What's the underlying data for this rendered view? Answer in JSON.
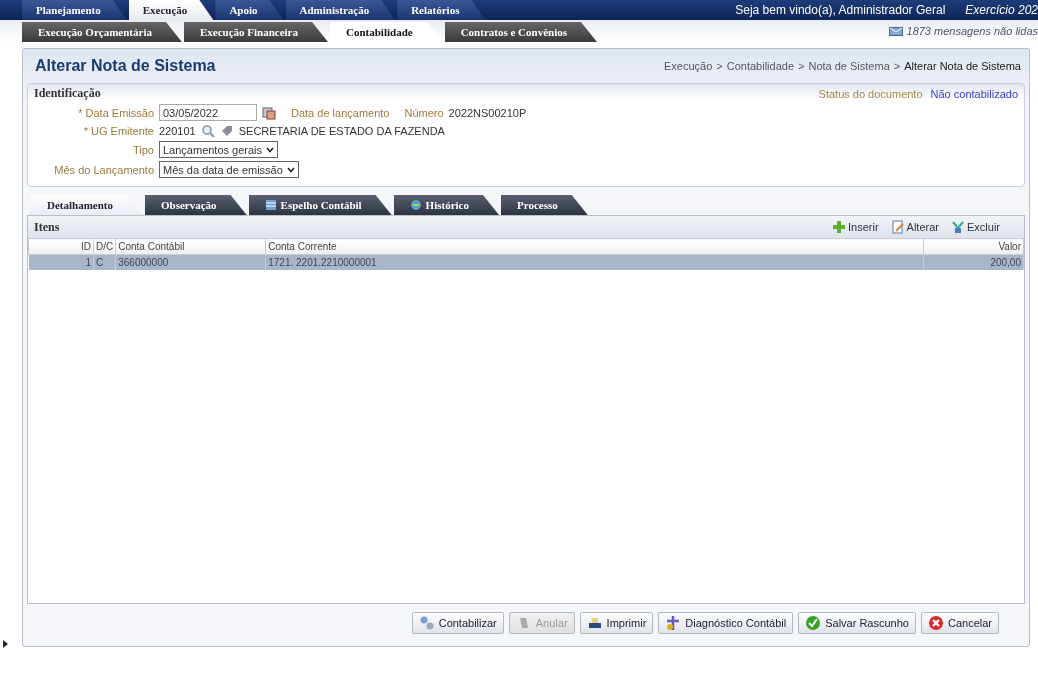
{
  "nav": {
    "tabs": [
      {
        "label": "Planejamento",
        "selected": false
      },
      {
        "label": "Execução",
        "selected": true
      },
      {
        "label": "Apoio",
        "selected": false
      },
      {
        "label": "Administração",
        "selected": false
      },
      {
        "label": "Relatórios",
        "selected": false
      }
    ],
    "welcome": "Seja bem vindo(a), Administrador Geral",
    "exercise": "Exercício 202"
  },
  "subnav": {
    "tabs": [
      {
        "label": "Execução Orçamentária",
        "selected": false
      },
      {
        "label": "Execução Financeira",
        "selected": false
      },
      {
        "label": "Contabilidade",
        "selected": true
      },
      {
        "label": "Contratos e Convênios",
        "selected": false
      }
    ],
    "messages": "1873 mensagens não lidas"
  },
  "page": {
    "title": "Alterar Nota de Sistema",
    "separator": ">",
    "breadcrumb": [
      "Execução",
      "Contabilidade",
      "Nota de Sistema",
      "Alterar Nota de Sistema"
    ]
  },
  "identificacao": {
    "title": "Identificação",
    "status_label": "Status do documento",
    "status_value": "Não contabilizado",
    "data_emissao": {
      "label": "* Data Emissão",
      "value": "03/05/2022"
    },
    "data_lancamento": {
      "label": "Data de lançamento"
    },
    "numero": {
      "label": "Número",
      "value": "2022NS00210P"
    },
    "ug_emitente": {
      "label": "* UG Emitente",
      "code": "220101",
      "name": "SECRETARIA DE ESTADO DA FAZENDA"
    },
    "tipo": {
      "label": "Tipo",
      "value": "Lançamentos gerais"
    },
    "mes": {
      "label": "Mês do Lançamento",
      "value": "Mês da data de emissão"
    }
  },
  "detail_tabs": [
    {
      "label": "Detalhamento",
      "selected": true
    },
    {
      "label": "Observação",
      "selected": false
    },
    {
      "label": "Espelho Contábil",
      "selected": false
    },
    {
      "label": "Histórico",
      "selected": false
    },
    {
      "label": "Processo",
      "selected": false
    }
  ],
  "itens": {
    "title": "Itens",
    "actions": [
      "Inserir",
      "Alterar",
      "Excluir"
    ],
    "columns": [
      "ID",
      "D/C",
      "Conta Contábil",
      "Conta Corrente",
      "Valor"
    ],
    "rows": [
      {
        "cells": [
          "1",
          "C",
          "366000000",
          "1721. 2201.2210000001",
          "200,00"
        ],
        "selected": true
      }
    ]
  },
  "buttons": [
    {
      "label": "Contabilizar",
      "disabled": false
    },
    {
      "label": "Anular",
      "disabled": true
    },
    {
      "label": "Imprimir",
      "disabled": false
    },
    {
      "label": "Diagnóstico Contábil",
      "disabled": false
    },
    {
      "label": "Salvar Rascunho",
      "disabled": false
    },
    {
      "label": "Cancelar",
      "disabled": false
    }
  ]
}
